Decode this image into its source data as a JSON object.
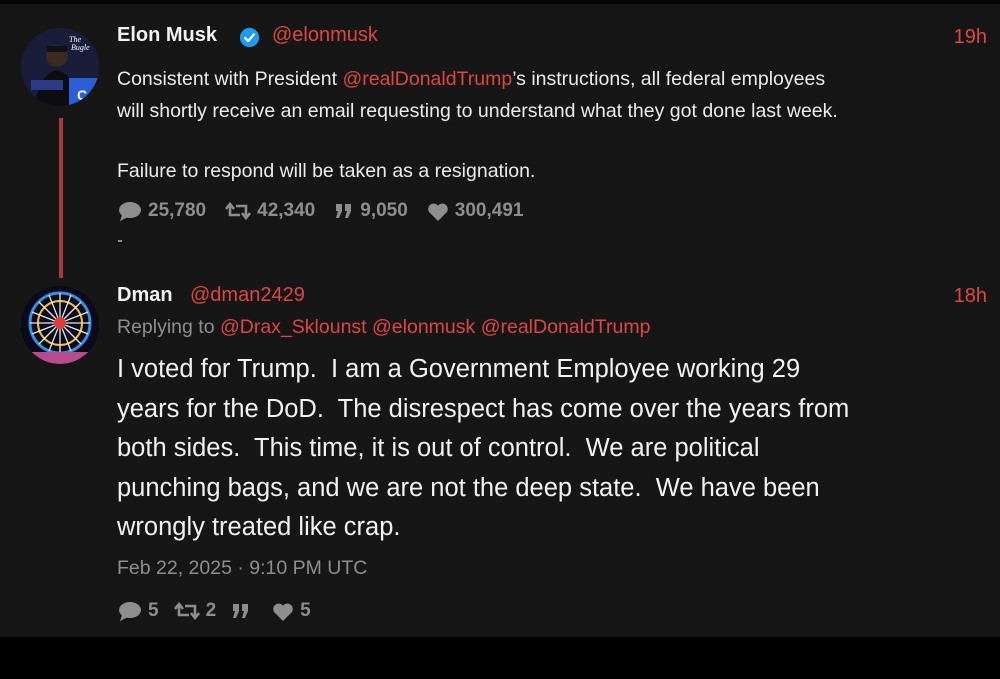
{
  "tweet1": {
    "name": "Elon Musk",
    "handle": "@elonmusk",
    "time": "19h",
    "text_pre": "Consistent with President ",
    "mention": "@realDonaldTrump",
    "text_post": "’s instructions, all federal employees",
    "line2": "will shortly receive an email requesting to understand what they got done last week.",
    "line3": "Failure to respond will be taken as a resignation.",
    "stats": {
      "replies": "25,780",
      "retweets": "42,340",
      "quotes": "9,050",
      "likes": "300,491"
    },
    "avatar_text": "The Bugle"
  },
  "tweet2": {
    "name": "Dman",
    "handle": "@dman2429",
    "time": "18h",
    "replying_label": "Replying to ",
    "replying_to": [
      "@Drax_Sklounst",
      "@elonmusk",
      "@realDonaldTrump"
    ],
    "lines": [
      "I voted for Trump.  I am a Government Employee working 29",
      "years for the DoD.  The disrespect has come over the years from",
      "both sides.  This time, it is out of control.  We are political",
      "punching bags, and we are not the deep state.  We have been",
      "wrongly treated like crap."
    ],
    "timestamp": "Feb 22, 2025 · 9:10 PM UTC",
    "stats": {
      "replies": "5",
      "retweets": "2",
      "quotes": "",
      "likes": "5"
    }
  },
  "colors": {
    "accent": "#e0463f",
    "background": "#161617",
    "text": "#ececec",
    "muted": "#8e8e8e",
    "thread_line": "#a8393a"
  }
}
